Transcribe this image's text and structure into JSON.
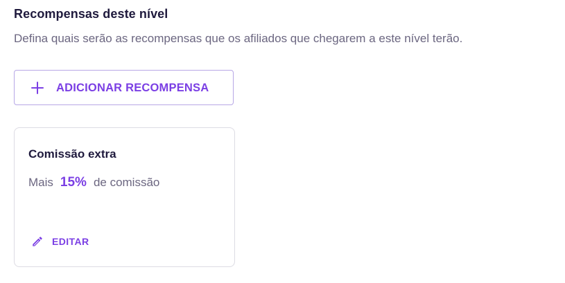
{
  "section": {
    "title": "Recompensas deste nível",
    "description": "Defina quais serão as recompensas que os afiliados que chegarem a este nível terão."
  },
  "add_button": {
    "icon": "plus-icon",
    "label": "ADICIONAR RECOMPENSA"
  },
  "reward_card": {
    "title": "Comissão extra",
    "prefix": "Mais",
    "value": "15%",
    "suffix": "de comissão",
    "edit": {
      "icon": "pencil-icon",
      "label": "EDITAR"
    }
  },
  "colors": {
    "accent": "#7b3fe4",
    "title": "#1f1a3d",
    "muted": "#6b6680",
    "button_border": "#b7a7e6",
    "card_border": "#dcdbe3"
  }
}
